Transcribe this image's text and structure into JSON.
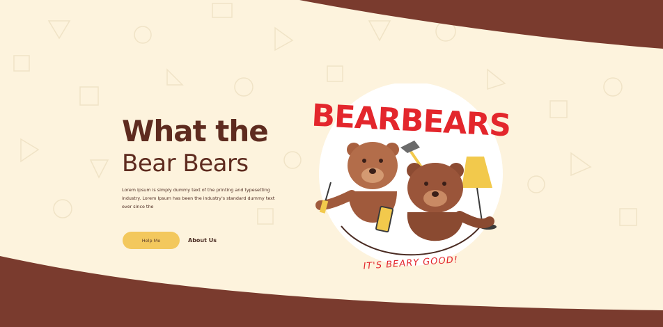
{
  "hero": {
    "title_line1": "What the",
    "title_line2": "Bear Bears",
    "description": "Lorem Ipsum is simply dummy text of the printing and typesetting industry. Lorem Ipsum has been the industry's standard dummy text ever since the"
  },
  "actions": {
    "primary_label": "Help Me",
    "secondary_label": "About Us"
  },
  "logo": {
    "brand": "BEARBEARS",
    "tagline": "IT'S BEARY GOOD!"
  },
  "colors": {
    "background": "#fdf3dd",
    "brown": "#7a3b2e",
    "title": "#5e2b1f",
    "button": "#f3c85d",
    "brand_red": "#e3262c"
  }
}
